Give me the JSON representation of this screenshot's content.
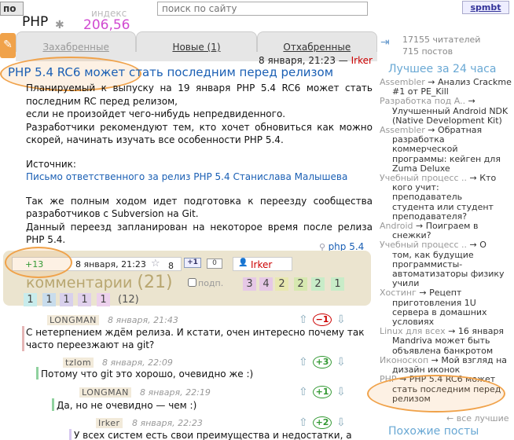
{
  "topbar": {
    "left_button": "по",
    "hub_title": "PHP",
    "index_label": "индекс",
    "index_value": "206,56",
    "search_placeholder": "поиск по сайту",
    "user_button": "spmbt"
  },
  "tabs": [
    {
      "label": "Захабренные"
    },
    {
      "label": "Новые (1)"
    },
    {
      "label": "Отхабренные"
    }
  ],
  "post": {
    "date": "8 января, 21:23 — ",
    "author": "Irker",
    "title": "PHP 5.4 RC6 может стать последним перед релизом",
    "paragraphs": [
      "Планируемый к выпуску на 19 января PHP 5.4 RC6 может стать последним RC перед релизом,",
      "если не произойдет чего-нибудь непредвиденного.",
      "Разработчики рекомендуют тем, кто хочет обновиться как можно скорей, начинать изучать все особенности PHP 5.4."
    ],
    "source_label": "Источник:",
    "source_link": "Письмо ответственного за релиз PHP 5.4 Станислава Малышева",
    "paragraphs2": [
      "Так же полным ходом идет подготовка к переезду сообщества разработчиков с Subversion на Git.",
      "Данный переезд запланирован на некоторое время после релиза PHP 5.4."
    ],
    "tag": "php 5.4"
  },
  "meta": {
    "score": "+13",
    "date": "8 января, 21:23",
    "favorites": "8",
    "plus_one": "+1",
    "plus_zero": "0",
    "author": "Irker",
    "comments_label": "комментарии",
    "comments_count": "(21)",
    "subscribe_label": "подп.",
    "total_new": "(12)"
  },
  "bubbles": [
    {
      "value": "3",
      "color": "#e6c8e6"
    },
    {
      "value": "4",
      "color": "#e6c8e6"
    },
    {
      "value": "2",
      "color": "#e8e8b0"
    },
    {
      "value": "2",
      "color": "#d6e8b0"
    },
    {
      "value": "2",
      "color": "#c8ecc8"
    },
    {
      "value": "1",
      "color": "#c8ecc8"
    },
    {
      "value": "1",
      "color": "#c8ecec"
    },
    {
      "value": "1",
      "color": "#c8dcec"
    },
    {
      "value": "1",
      "color": "#d8d0ec"
    },
    {
      "value": "1",
      "color": "#e0d0ec"
    },
    {
      "value": "1",
      "color": "#ecd0ec"
    }
  ],
  "comments": [
    {
      "author": "LONGMAN",
      "date": "8 января, 21:43",
      "text1": "С нетерпением ждём релиза. И кстати, очен интересно почему так",
      "text2": "часто переезжают на git?",
      "score": "−1"
    },
    {
      "author": "tzlom",
      "date": "8 января, 22:09",
      "text1": "Потому что git это хорошо, очевидно же :)",
      "score": "+3"
    },
    {
      "author": "LONGMAN",
      "date": "8 января, 22:19",
      "text1": "Да, но не очевидно — чем :)",
      "score": "+1"
    },
    {
      "author": "Irker",
      "date": "8 января, 22:23",
      "text1": "У всех систем есть свои преимущества и недостатки, а",
      "score": "+2"
    }
  ],
  "sidebar": {
    "readers": "17155 читателей",
    "posts": "715 постов",
    "best_title": "Лучшее за 24 часа",
    "best": [
      {
        "hub": "Assembler",
        "title": "Анализ Crackme",
        "cont": [
          "#1 от PE_Kill"
        ]
      },
      {
        "hub": "Разработка под A..",
        "title": "",
        "cont": [
          "Улучшенный Android NDK",
          "(Native Development Kit)"
        ]
      },
      {
        "hub": "Assembler",
        "title": "Обратная",
        "cont": [
          "разработка коммерческой",
          "программы: кейген для",
          "Zuma Deluxe"
        ]
      },
      {
        "hub": "Учебный процесс ..",
        "title": "Кто",
        "cont": [
          "кого учит: преподаватель",
          "студента или студент",
          "преподавателя?"
        ]
      },
      {
        "hub": "Android",
        "title": "Поиграем в",
        "cont": [
          "снежки?"
        ]
      },
      {
        "hub": "Учебный процесс ..",
        "title": "О",
        "cont": [
          "том, как будущие",
          "программисты-",
          "автоматизаторы физику",
          "учили"
        ]
      },
      {
        "hub": "Хостинг",
        "title": "Рецепт",
        "cont": [
          "приготовления 1U",
          "сервера в домашних",
          "условиях"
        ]
      },
      {
        "hub": "Linux для всех",
        "title": "16 января",
        "cont": [
          "Mandriva может быть",
          "объявлена банкротом"
        ]
      },
      {
        "hub": "Иконоскоп",
        "title": "Мой взгляд на",
        "cont": [
          "дизайн иконок"
        ]
      },
      {
        "hub": "PHP",
        "title": "PHP 5.4 RC6 может",
        "cont": [
          "стать последним перед",
          "релизом"
        ]
      }
    ],
    "all_best": "← все лучшие",
    "similar_title": "Похожие посты"
  }
}
